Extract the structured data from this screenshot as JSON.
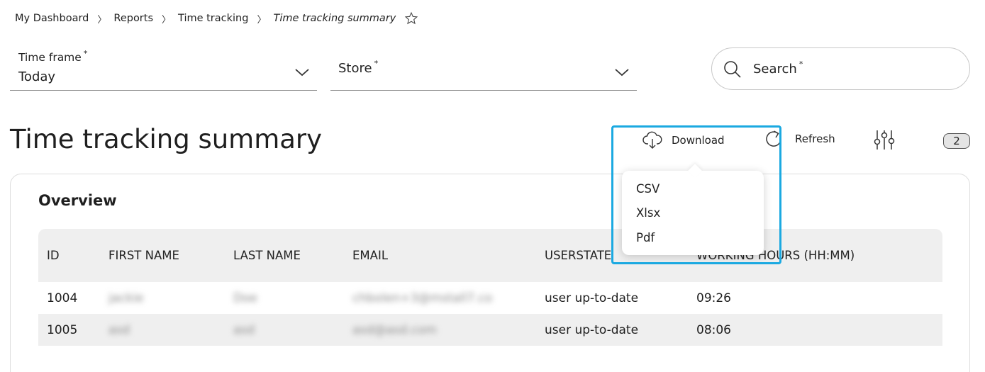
{
  "breadcrumb": {
    "items": [
      "My Dashboard",
      "Reports",
      "Time tracking"
    ],
    "current": "Time tracking summary",
    "separator": "〉"
  },
  "filters": {
    "timeframe": {
      "label": "Time frame",
      "required_mark": "*",
      "value": "Today"
    },
    "store": {
      "label": "Store",
      "required_mark": "*",
      "value": ""
    },
    "search": {
      "placeholder": "Search",
      "required_mark": "*"
    }
  },
  "page": {
    "title": "Time tracking summary"
  },
  "toolbar": {
    "download_label": "Download",
    "refresh_label": "Refresh",
    "filter_count": "2"
  },
  "download_menu": {
    "options": [
      "CSV",
      "Xlsx",
      "Pdf"
    ]
  },
  "overview": {
    "title": "Overview",
    "columns": [
      "ID",
      "FIRST NAME",
      "LAST NAME",
      "EMAIL",
      "USERSTATE",
      "WORKING HOURS (HH:MM)"
    ],
    "rows": [
      {
        "id": "1004",
        "first_name": "jackie",
        "last_name": "Doe",
        "email": "chbolen+3@mstall7.co",
        "userstate": "user up-to-date",
        "hours": "09:26"
      },
      {
        "id": "1005",
        "first_name": "asd",
        "last_name": "asd",
        "email": "asd@asd.com",
        "userstate": "user up-to-date",
        "hours": "08:06"
      }
    ]
  },
  "colors": {
    "highlight": "#1ba9e1",
    "table_header_bg": "#efefef"
  }
}
